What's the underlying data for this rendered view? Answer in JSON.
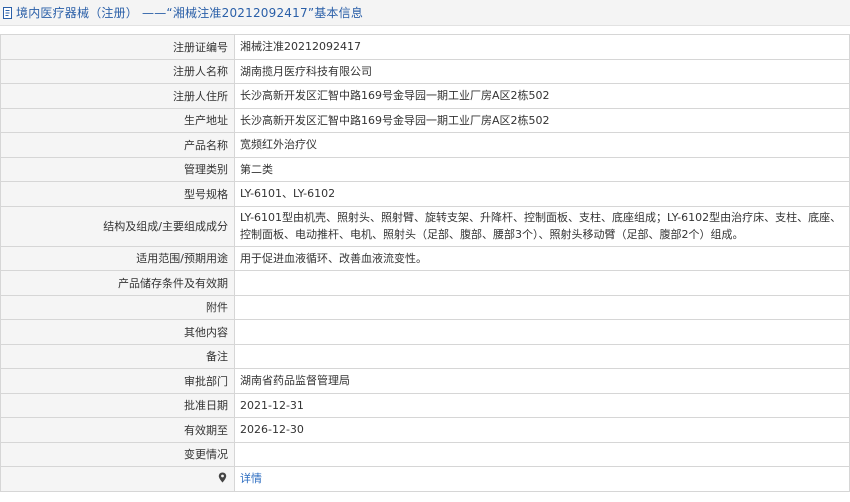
{
  "page": {
    "title": "境内医疗器械（注册） ——“湘械注准20212092417”基本信息"
  },
  "rows": [
    {
      "label": "注册证编号",
      "value": "湘械注准20212092417"
    },
    {
      "label": "注册人名称",
      "value": "湖南揽月医疗科技有限公司"
    },
    {
      "label": "注册人住所",
      "value": "长沙高新开发区汇智中路169号金导园一期工业厂房A区2栋502"
    },
    {
      "label": "生产地址",
      "value": "长沙高新开发区汇智中路169号金导园一期工业厂房A区2栋502"
    },
    {
      "label": "产品名称",
      "value": "宽频红外治疗仪"
    },
    {
      "label": "管理类别",
      "value": "第二类"
    },
    {
      "label": "型号规格",
      "value": "LY-6101、LY-6102"
    },
    {
      "label": "结构及组成/主要组成成分",
      "value": "LY-6101型由机壳、照射头、照射臂、旋转支架、升降杆、控制面板、支柱、底座组成；LY-6102型由治疗床、支柱、底座、控制面板、电动推杆、电机、照射头（足部、腹部、腰部3个）、照射头移动臂（足部、腹部2个）组成。"
    },
    {
      "label": "适用范围/预期用途",
      "value": "用于促进血液循环、改善血液流变性。"
    },
    {
      "label": "产品储存条件及有效期",
      "value": ""
    },
    {
      "label": "附件",
      "value": ""
    },
    {
      "label": "其他内容",
      "value": ""
    },
    {
      "label": "备注",
      "value": ""
    },
    {
      "label": "审批部门",
      "value": "湖南省药品监督管理局"
    },
    {
      "label": "批准日期",
      "value": "2021-12-31"
    },
    {
      "label": "有效期至",
      "value": "2026-12-30"
    },
    {
      "label": "变更情况",
      "value": ""
    }
  ],
  "detail": {
    "label": "",
    "link_text": "详情",
    "icon": "map-pin-icon"
  },
  "colors": {
    "title_text": "#2a5fa8",
    "label_bg": "#f5f5f5",
    "border": "#d6d6d6",
    "link": "#2a6bc0"
  }
}
